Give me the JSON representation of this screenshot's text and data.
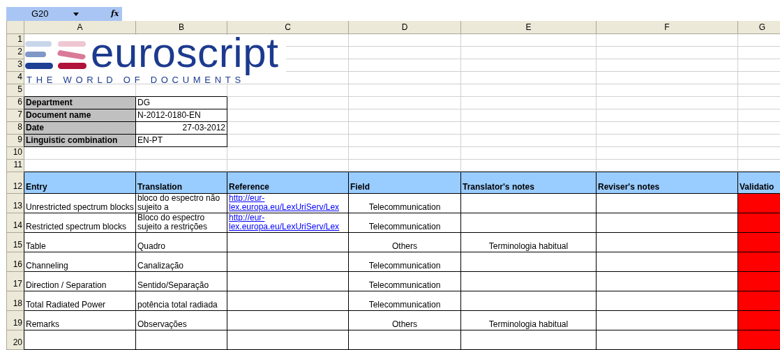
{
  "name_box": {
    "value": "G20",
    "formula_label": "fx"
  },
  "columns": [
    "A",
    "B",
    "C",
    "D",
    "E",
    "F",
    "G"
  ],
  "row_numbers": [
    "1",
    "2",
    "3",
    "4",
    "5",
    "6",
    "7",
    "8",
    "9",
    "10",
    "11",
    "12",
    "13",
    "14",
    "15",
    "16",
    "17",
    "18",
    "19",
    "20"
  ],
  "logo": {
    "wordmark": "euroscript",
    "tagline": "THE WORLD OF DOCUMENTS"
  },
  "info": [
    {
      "label": "Department",
      "value": "DG",
      "right_aligned": false
    },
    {
      "label": "Document name",
      "value": "N-2012-0180-EN",
      "right_aligned": false
    },
    {
      "label": "Date",
      "value": "27-03-2012",
      "right_aligned": true
    },
    {
      "label": "Linguistic combination",
      "value": "EN-PT",
      "right_aligned": false
    }
  ],
  "table": {
    "columns": [
      "Entry",
      "Translation",
      "Reference",
      "Field",
      "Translator's notes",
      "Reviser's notes",
      "Validatio"
    ],
    "rows": [
      {
        "entry": "Unrestricted spectrum blocks",
        "translation": "bloco do espectro não sujeito a",
        "reference": "http://eur-lex.europa.eu/LexUriServ/Lex",
        "field": "Telecommunication",
        "color": "#ff0000"
      },
      {
        "entry": "Restricted spectrum blocks",
        "translation": "Bloco do espectro sujeito a restrições",
        "reference": "http://eur-lex.europa.eu/LexUriServ/Lex",
        "field": "Telecommunication",
        "color": "#ff0000"
      },
      {
        "entry": "Table",
        "translation": "Quadro",
        "field": "Others",
        "translator_notes": "Terminologia habitual",
        "color": "#ff0000"
      },
      {
        "entry": "Channeling",
        "translation": "Canalização",
        "field": "Telecommunication",
        "color": "#ff0000"
      },
      {
        "entry": "Direction / Separation",
        "translation": "Sentido/Separação",
        "field": "Telecommunication",
        "color": "#ff0000"
      },
      {
        "entry": "Total Radiated Power",
        "translation": "potência total radiada",
        "field": "Telecommunication",
        "color": "#ff0000"
      },
      {
        "entry": "Remarks",
        "translation": "Observações",
        "field": "Others",
        "translator_notes": "Terminologia habitual",
        "color": "#ff0000"
      },
      {
        "color": "#ff0000"
      }
    ]
  }
}
